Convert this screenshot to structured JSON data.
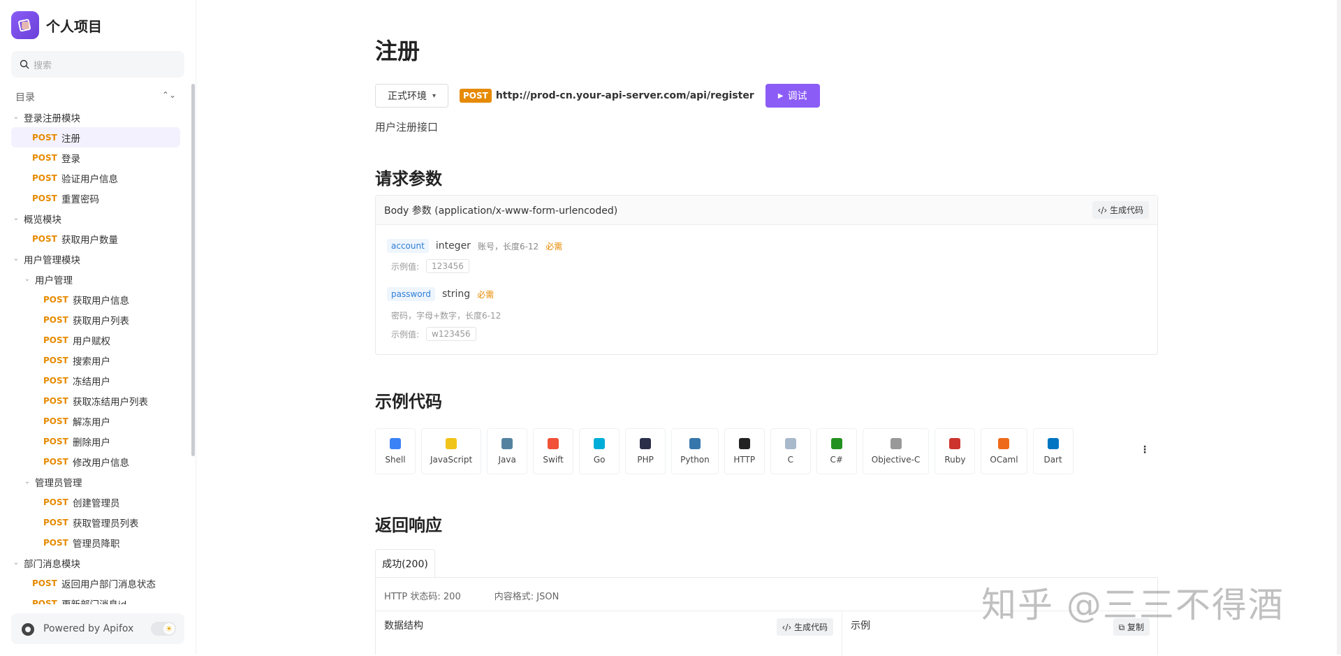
{
  "brand": {
    "title": "个人项目"
  },
  "search": {
    "placeholder": "搜索"
  },
  "toc": {
    "label": "目录",
    "collapse": "⌄"
  },
  "tree": [
    {
      "level": 0,
      "type": "folder",
      "label": "登录注册模块"
    },
    {
      "level": 1,
      "type": "api",
      "method": "POST",
      "label": "注册",
      "selected": true
    },
    {
      "level": 1,
      "type": "api",
      "method": "POST",
      "label": "登录"
    },
    {
      "level": 1,
      "type": "api",
      "method": "POST",
      "label": "验证用户信息"
    },
    {
      "level": 1,
      "type": "api",
      "method": "POST",
      "label": "重置密码"
    },
    {
      "level": 0,
      "type": "folder",
      "label": "概览模块"
    },
    {
      "level": 1,
      "type": "api",
      "method": "POST",
      "label": "获取用户数量"
    },
    {
      "level": 0,
      "type": "folder",
      "label": "用户管理模块"
    },
    {
      "level": 1,
      "type": "folder",
      "label": "用户管理"
    },
    {
      "level": 2,
      "type": "api",
      "method": "POST",
      "label": "获取用户信息"
    },
    {
      "level": 2,
      "type": "api",
      "method": "POST",
      "label": "获取用户列表"
    },
    {
      "level": 2,
      "type": "api",
      "method": "POST",
      "label": "用户赋权"
    },
    {
      "level": 2,
      "type": "api",
      "method": "POST",
      "label": "搜索用户"
    },
    {
      "level": 2,
      "type": "api",
      "method": "POST",
      "label": "冻结用户"
    },
    {
      "level": 2,
      "type": "api",
      "method": "POST",
      "label": "获取冻结用户列表"
    },
    {
      "level": 2,
      "type": "api",
      "method": "POST",
      "label": "解冻用户"
    },
    {
      "level": 2,
      "type": "api",
      "method": "POST",
      "label": "删除用户"
    },
    {
      "level": 2,
      "type": "api",
      "method": "POST",
      "label": "修改用户信息"
    },
    {
      "level": 1,
      "type": "folder",
      "label": "管理员管理"
    },
    {
      "level": 2,
      "type": "api",
      "method": "POST",
      "label": "创建管理员"
    },
    {
      "level": 2,
      "type": "api",
      "method": "POST",
      "label": "获取管理员列表"
    },
    {
      "level": 2,
      "type": "api",
      "method": "POST",
      "label": "管理员降职"
    },
    {
      "level": 0,
      "type": "folder",
      "label": "部门消息模块"
    },
    {
      "level": 1,
      "type": "api",
      "method": "POST",
      "label": "返回用户部门消息状态"
    },
    {
      "level": 1,
      "type": "api",
      "method": "POST",
      "label": "更新部门消息id"
    }
  ],
  "footer": {
    "label": "Powered by Apifox"
  },
  "page": {
    "title": "注册",
    "env": "正式环境",
    "method": "POST",
    "url": "http://prod-cn.your-api-server.com/api/register",
    "debug": "调试",
    "description": "用户注册接口"
  },
  "request": {
    "heading": "请求参数",
    "body_label": "Body 参数 (application/x-www-form-urlencoded)",
    "gen_code": "生成代码",
    "example_label": "示例值:",
    "params": [
      {
        "name": "account",
        "type": "integer",
        "note": "账号，长度6-12",
        "required": "必需",
        "example": "123456"
      },
      {
        "name": "password",
        "type": "string",
        "note": "密码，字母+数字，长度6-12",
        "required": "必需",
        "example": "w123456"
      }
    ]
  },
  "samples": {
    "heading": "示例代码",
    "langs": [
      {
        "label": "Shell",
        "icon": "shell-icon",
        "color": "#3b82f6"
      },
      {
        "label": "JavaScript",
        "icon": "js-icon",
        "color": "#f0c419"
      },
      {
        "label": "Java",
        "icon": "java-icon",
        "color": "#5382a1"
      },
      {
        "label": "Swift",
        "icon": "swift-icon",
        "color": "#f05138"
      },
      {
        "label": "Go",
        "icon": "go-icon",
        "color": "#00add8"
      },
      {
        "label": "PHP",
        "icon": "php-icon",
        "color": "#2c2f4a"
      },
      {
        "label": "Python",
        "icon": "python-icon",
        "color": "#3776ab"
      },
      {
        "label": "HTTP",
        "icon": "http-icon",
        "color": "#222222"
      },
      {
        "label": "C",
        "icon": "c-icon",
        "color": "#a8b9cc"
      },
      {
        "label": "C#",
        "icon": "csharp-icon",
        "color": "#239120"
      },
      {
        "label": "Objective-C",
        "icon": "objc-icon",
        "color": "#999999"
      },
      {
        "label": "Ruby",
        "icon": "ruby-icon",
        "color": "#cc342d"
      },
      {
        "label": "OCaml",
        "icon": "ocaml-icon",
        "color": "#ee6a1a"
      },
      {
        "label": "Dart",
        "icon": "dart-icon",
        "color": "#0175c2"
      }
    ]
  },
  "response": {
    "heading": "返回响应",
    "tab": "成功(200)",
    "status": "HTTP 状态码: 200",
    "format": "内容格式: JSON",
    "structure": "数据结构",
    "gen_code": "生成代码",
    "example": "示例",
    "copy": "复制"
  },
  "watermark": "知乎 @三三不得酒"
}
